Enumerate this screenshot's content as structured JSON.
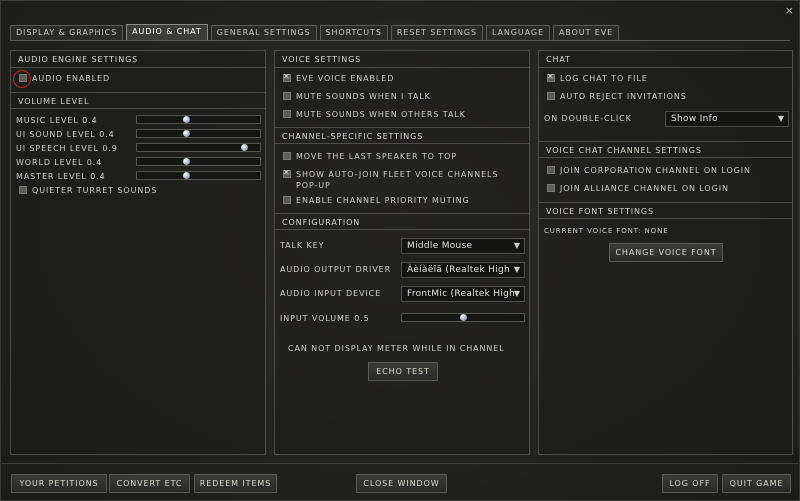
{
  "window": {
    "close_glyph": "×"
  },
  "tabs": [
    {
      "label": "Display & Graphics",
      "active": false
    },
    {
      "label": "Audio & Chat",
      "active": true
    },
    {
      "label": "General Settings",
      "active": false
    },
    {
      "label": "Shortcuts",
      "active": false
    },
    {
      "label": "Reset Settings",
      "active": false
    },
    {
      "label": "Language",
      "active": false
    },
    {
      "label": "About EVE",
      "active": false
    }
  ],
  "audio_engine": {
    "header": "Audio Engine Settings",
    "audio_enabled": {
      "label": "Audio Enabled",
      "checked": false
    }
  },
  "volume": {
    "header": "Volume Level",
    "levels": [
      {
        "label": "Music Level 0.4",
        "value": 0.4
      },
      {
        "label": "UI Sound Level 0.4",
        "value": 0.4
      },
      {
        "label": "UI Speech Level 0.9",
        "value": 0.9
      },
      {
        "label": "World Level 0.4",
        "value": 0.4
      },
      {
        "label": "Master Level 0.4",
        "value": 0.4
      }
    ],
    "quieter_turret": {
      "label": "Quieter Turret Sounds",
      "checked": false
    }
  },
  "voice": {
    "header": "Voice Settings",
    "eve_voice": {
      "label": "EVE Voice Enabled",
      "checked": true
    },
    "mute_talk": {
      "label": "Mute Sounds when I talk",
      "checked": false
    },
    "mute_others": {
      "label": "Mute Sounds when others talk",
      "checked": false
    }
  },
  "channel_specific": {
    "header": "Channel-Specific Settings",
    "move_speaker": {
      "label": "Move the last speaker to top",
      "checked": false
    },
    "auto_join_line1": "Show Auto-Join Fleet Voice Channels",
    "auto_join_line2": "Pop-up",
    "auto_join_checked": true,
    "priority_muting": {
      "label": "Enable Channel Priority Muting",
      "checked": false
    }
  },
  "configuration": {
    "header": "Configuration",
    "talk_key": {
      "label": "Talk Key",
      "value": "Middle Mouse"
    },
    "output_driver": {
      "label": "Audio Output Driver",
      "value": "Àèíàëîã (Realtek High"
    },
    "input_device": {
      "label": "Audio Input Device",
      "value": "FrontMic (Realtek High"
    },
    "input_volume": {
      "label": "Input Volume 0.5",
      "value": 0.5
    },
    "meter_note": "Can not display meter while in channel",
    "echo_test": "Echo Test"
  },
  "chat": {
    "header": "Chat",
    "log_chat": {
      "label": "Log Chat To File",
      "checked": true
    },
    "auto_reject": {
      "label": "Auto Reject Invitations",
      "checked": false
    },
    "double_click": {
      "label": "On Double-Click",
      "value": "Show Info"
    }
  },
  "voice_chat_channels": {
    "header": "Voice Chat Channel Settings",
    "corp": {
      "label": "Join Corporation Channel on Login",
      "checked": false
    },
    "alliance": {
      "label": "Join Alliance Channel on Login",
      "checked": false
    }
  },
  "voice_font": {
    "header": "Voice Font Settings",
    "current": "Current Voice Font: None",
    "change_button": "Change Voice Font"
  },
  "bottom": {
    "petitions": "Your Petitions",
    "convert": "Convert ETC",
    "redeem": "Redeem Items",
    "close_window": "Close Window",
    "log_off": "Log Off",
    "quit": "Quit Game"
  }
}
